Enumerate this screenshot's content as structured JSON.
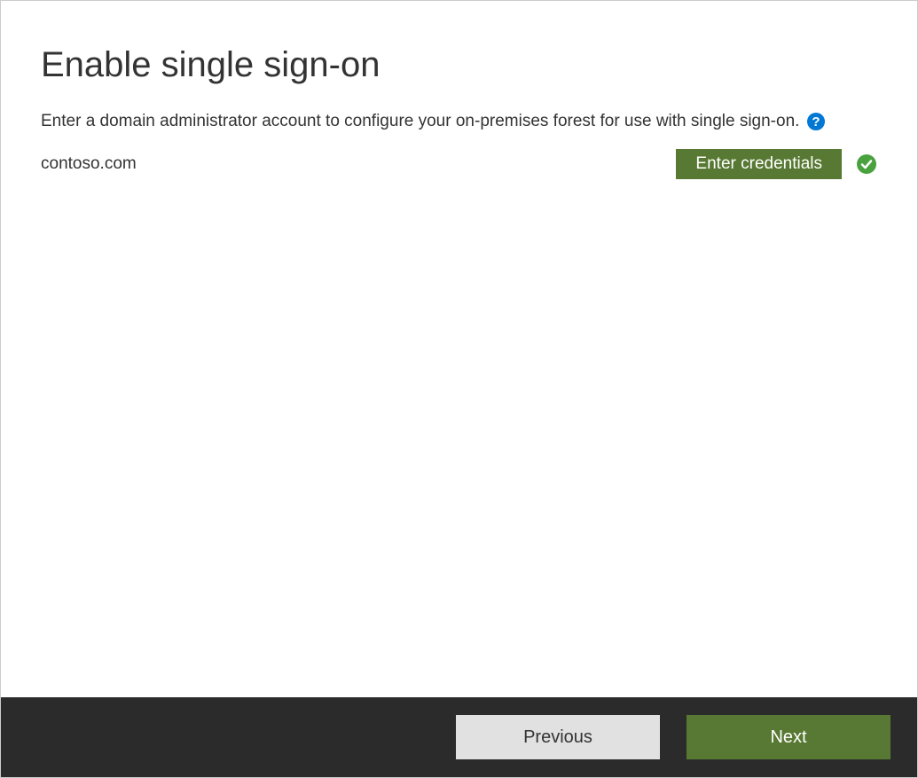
{
  "page": {
    "title": "Enable single sign-on",
    "instruction": "Enter a domain administrator account to configure your on-premises forest for use with single sign-on."
  },
  "domain": {
    "name": "contoso.com",
    "credentials_button_label": "Enter credentials"
  },
  "footer": {
    "previous_label": "Previous",
    "next_label": "Next"
  },
  "colors": {
    "accent_green": "#587933",
    "footer_bg": "#2b2b2b",
    "help_blue": "#0078d4",
    "success_green": "#4aa23f"
  }
}
